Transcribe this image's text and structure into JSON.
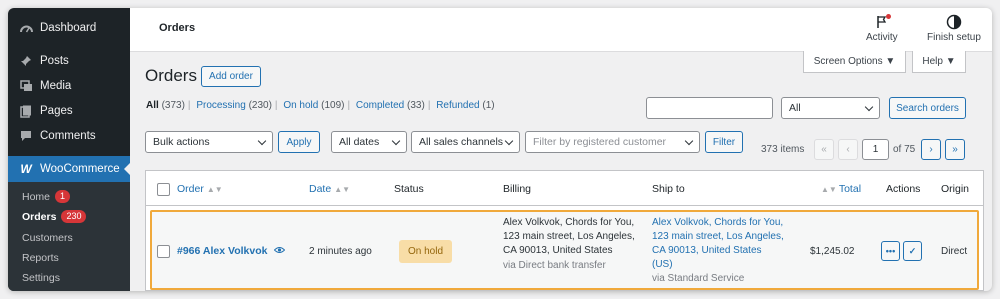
{
  "sidebar": {
    "items": [
      {
        "label": "Dashboard",
        "icon": "dashboard-icon"
      },
      {
        "label": "Posts",
        "icon": "pin-icon"
      },
      {
        "label": "Media",
        "icon": "media-icon"
      },
      {
        "label": "Pages",
        "icon": "pages-icon"
      },
      {
        "label": "Comments",
        "icon": "comment-icon"
      },
      {
        "label": "WooCommerce",
        "icon": "woo-icon"
      }
    ],
    "woo_icon_glyph": "W",
    "submenu": [
      {
        "label": "Home",
        "count": "1"
      },
      {
        "label": "Orders",
        "count": "230"
      },
      {
        "label": "Customers"
      },
      {
        "label": "Reports"
      },
      {
        "label": "Settings"
      }
    ]
  },
  "topbar": {
    "title": "Orders",
    "activity_label": "Activity",
    "finish_setup_label": "Finish setup"
  },
  "screen_options": {
    "screen_options_label": "Screen Options ▼",
    "help_label": "Help ▼"
  },
  "page": {
    "heading": "Orders",
    "add_order_label": "Add order"
  },
  "status_filters": [
    {
      "label": "All",
      "count": "(373)"
    },
    {
      "label": "Processing",
      "count": "(230)"
    },
    {
      "label": "On hold",
      "count": "(109)"
    },
    {
      "label": "Completed",
      "count": "(33)"
    },
    {
      "label": "Refunded",
      "count": "(1)"
    }
  ],
  "search": {
    "value": "",
    "scope_select": "All",
    "button_label": "Search orders"
  },
  "filters": {
    "bulk_actions": "Bulk actions",
    "apply_label": "Apply",
    "dates": "All dates",
    "channels": "All sales channels",
    "customer_placeholder": "Filter by registered customer",
    "filter_label": "Filter"
  },
  "pagination": {
    "items": "373 items",
    "first": "«",
    "prev": "‹",
    "current": "1",
    "of": "of 75",
    "next": "›",
    "last": "»"
  },
  "table": {
    "headers": {
      "order": "Order",
      "date": "Date",
      "status": "Status",
      "billing": "Billing",
      "ship_to": "Ship to",
      "total": "Total",
      "actions": "Actions",
      "origin": "Origin"
    },
    "rows": [
      {
        "order": "#966 Alex Volkvok",
        "date": "2 minutes ago",
        "status": "On hold",
        "billing": [
          "Alex Volkvok, Chords for You,",
          "123 main street, Los Angeles,",
          "CA 90013, United States"
        ],
        "billing_method": "via Direct bank transfer",
        "ship_to": [
          "Alex Volkvok, Chords for You,",
          "123 main street, Los Angeles,",
          "CA 90013, United States",
          "(US)"
        ],
        "ship_method": "via Standard Service",
        "total": "$1,245.02",
        "action_more": "•••",
        "action_complete": "✓",
        "origin": "Direct"
      }
    ]
  }
}
